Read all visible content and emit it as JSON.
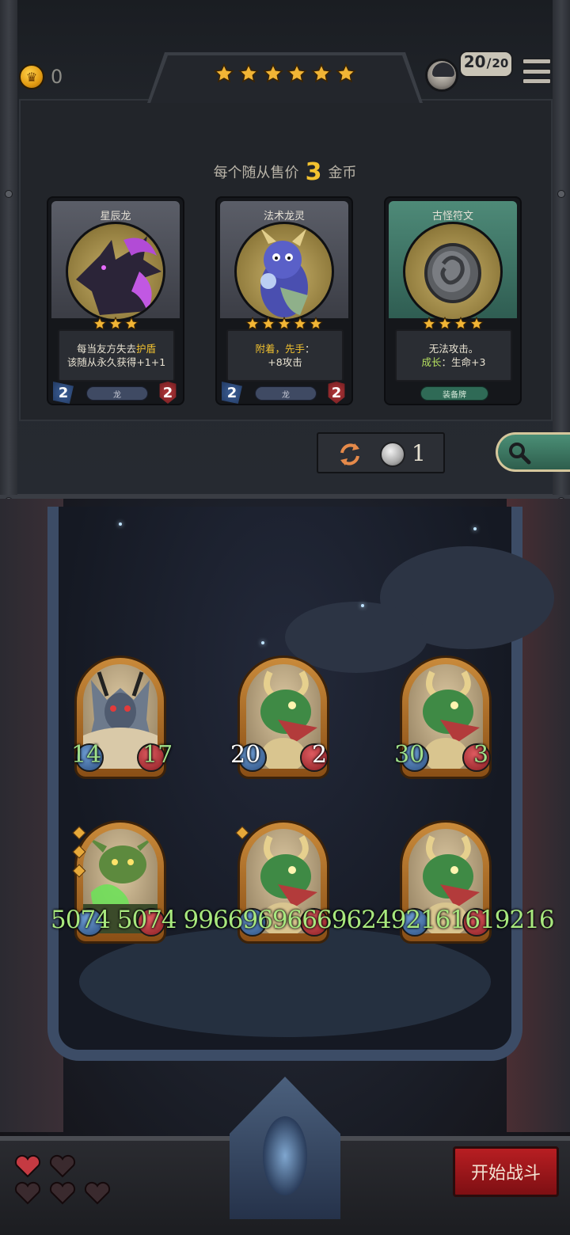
{
  "header": {
    "gold": "0",
    "tavern_stars": 6,
    "population_current": "20",
    "population_separator": "/",
    "population_max": "20"
  },
  "shop": {
    "sell_hint_prefix": "每个随从售价",
    "sell_price": "3",
    "sell_hint_suffix": "金币",
    "cards": [
      {
        "name": "星辰龙",
        "stars": 3,
        "desc_lines": [
          {
            "parts": [
              {
                "t": "每当友方失去"
              },
              {
                "t": "护盾",
                "k": true
              }
            ]
          },
          {
            "parts": [
              {
                "t": "该随从永久获得+1+1"
              }
            ]
          }
        ],
        "attack": "2",
        "health": "2",
        "tribe": "龙",
        "art": "dragon-purple"
      },
      {
        "name": "法术龙灵",
        "stars": 5,
        "desc_lines": [
          {
            "parts": [
              {
                "t": "附着，先手",
                "k": true
              },
              {
                "t": "："
              }
            ]
          },
          {
            "parts": [
              {
                "t": "+8攻击"
              }
            ]
          }
        ],
        "attack": "2",
        "health": "2",
        "tribe": "龙",
        "art": "dragon-blue"
      },
      {
        "name": "古怪符文",
        "stars": 4,
        "desc_lines": [
          {
            "parts": [
              {
                "t": "无法攻击。"
              }
            ]
          },
          {
            "parts": [
              {
                "t": "成长",
                "g": true
              },
              {
                "t": "：生命+3"
              }
            ]
          }
        ],
        "attack": "",
        "health": "",
        "tribe": "装备牌",
        "art": "rune-stone"
      }
    ],
    "refresh_cost": "1"
  },
  "board": {
    "front_row": [
      {
        "attack": "14",
        "health": "17",
        "color": "green",
        "art": "demon-lord"
      },
      {
        "attack": "20",
        "health": "2",
        "color": "white",
        "art": "green-dragon"
      },
      {
        "attack": "30",
        "health": "3",
        "color": "green",
        "art": "green-dragon"
      }
    ],
    "back_row_stat_text": "5074 5074 9966969666962492161619216",
    "back_row": [
      {
        "art": "goblin-mage",
        "pips": 3
      },
      {
        "art": "green-dragon",
        "pips": 1
      },
      {
        "art": "green-dragon",
        "pips": 0
      }
    ]
  },
  "footer": {
    "lives_full": 1,
    "lives_total": 5,
    "start_button": "开始战斗"
  },
  "colors": {
    "gold": "#f2c230",
    "stat_green": "#9fe08a",
    "start_red": "#b81e22",
    "equip_green": "#4e8a78"
  }
}
